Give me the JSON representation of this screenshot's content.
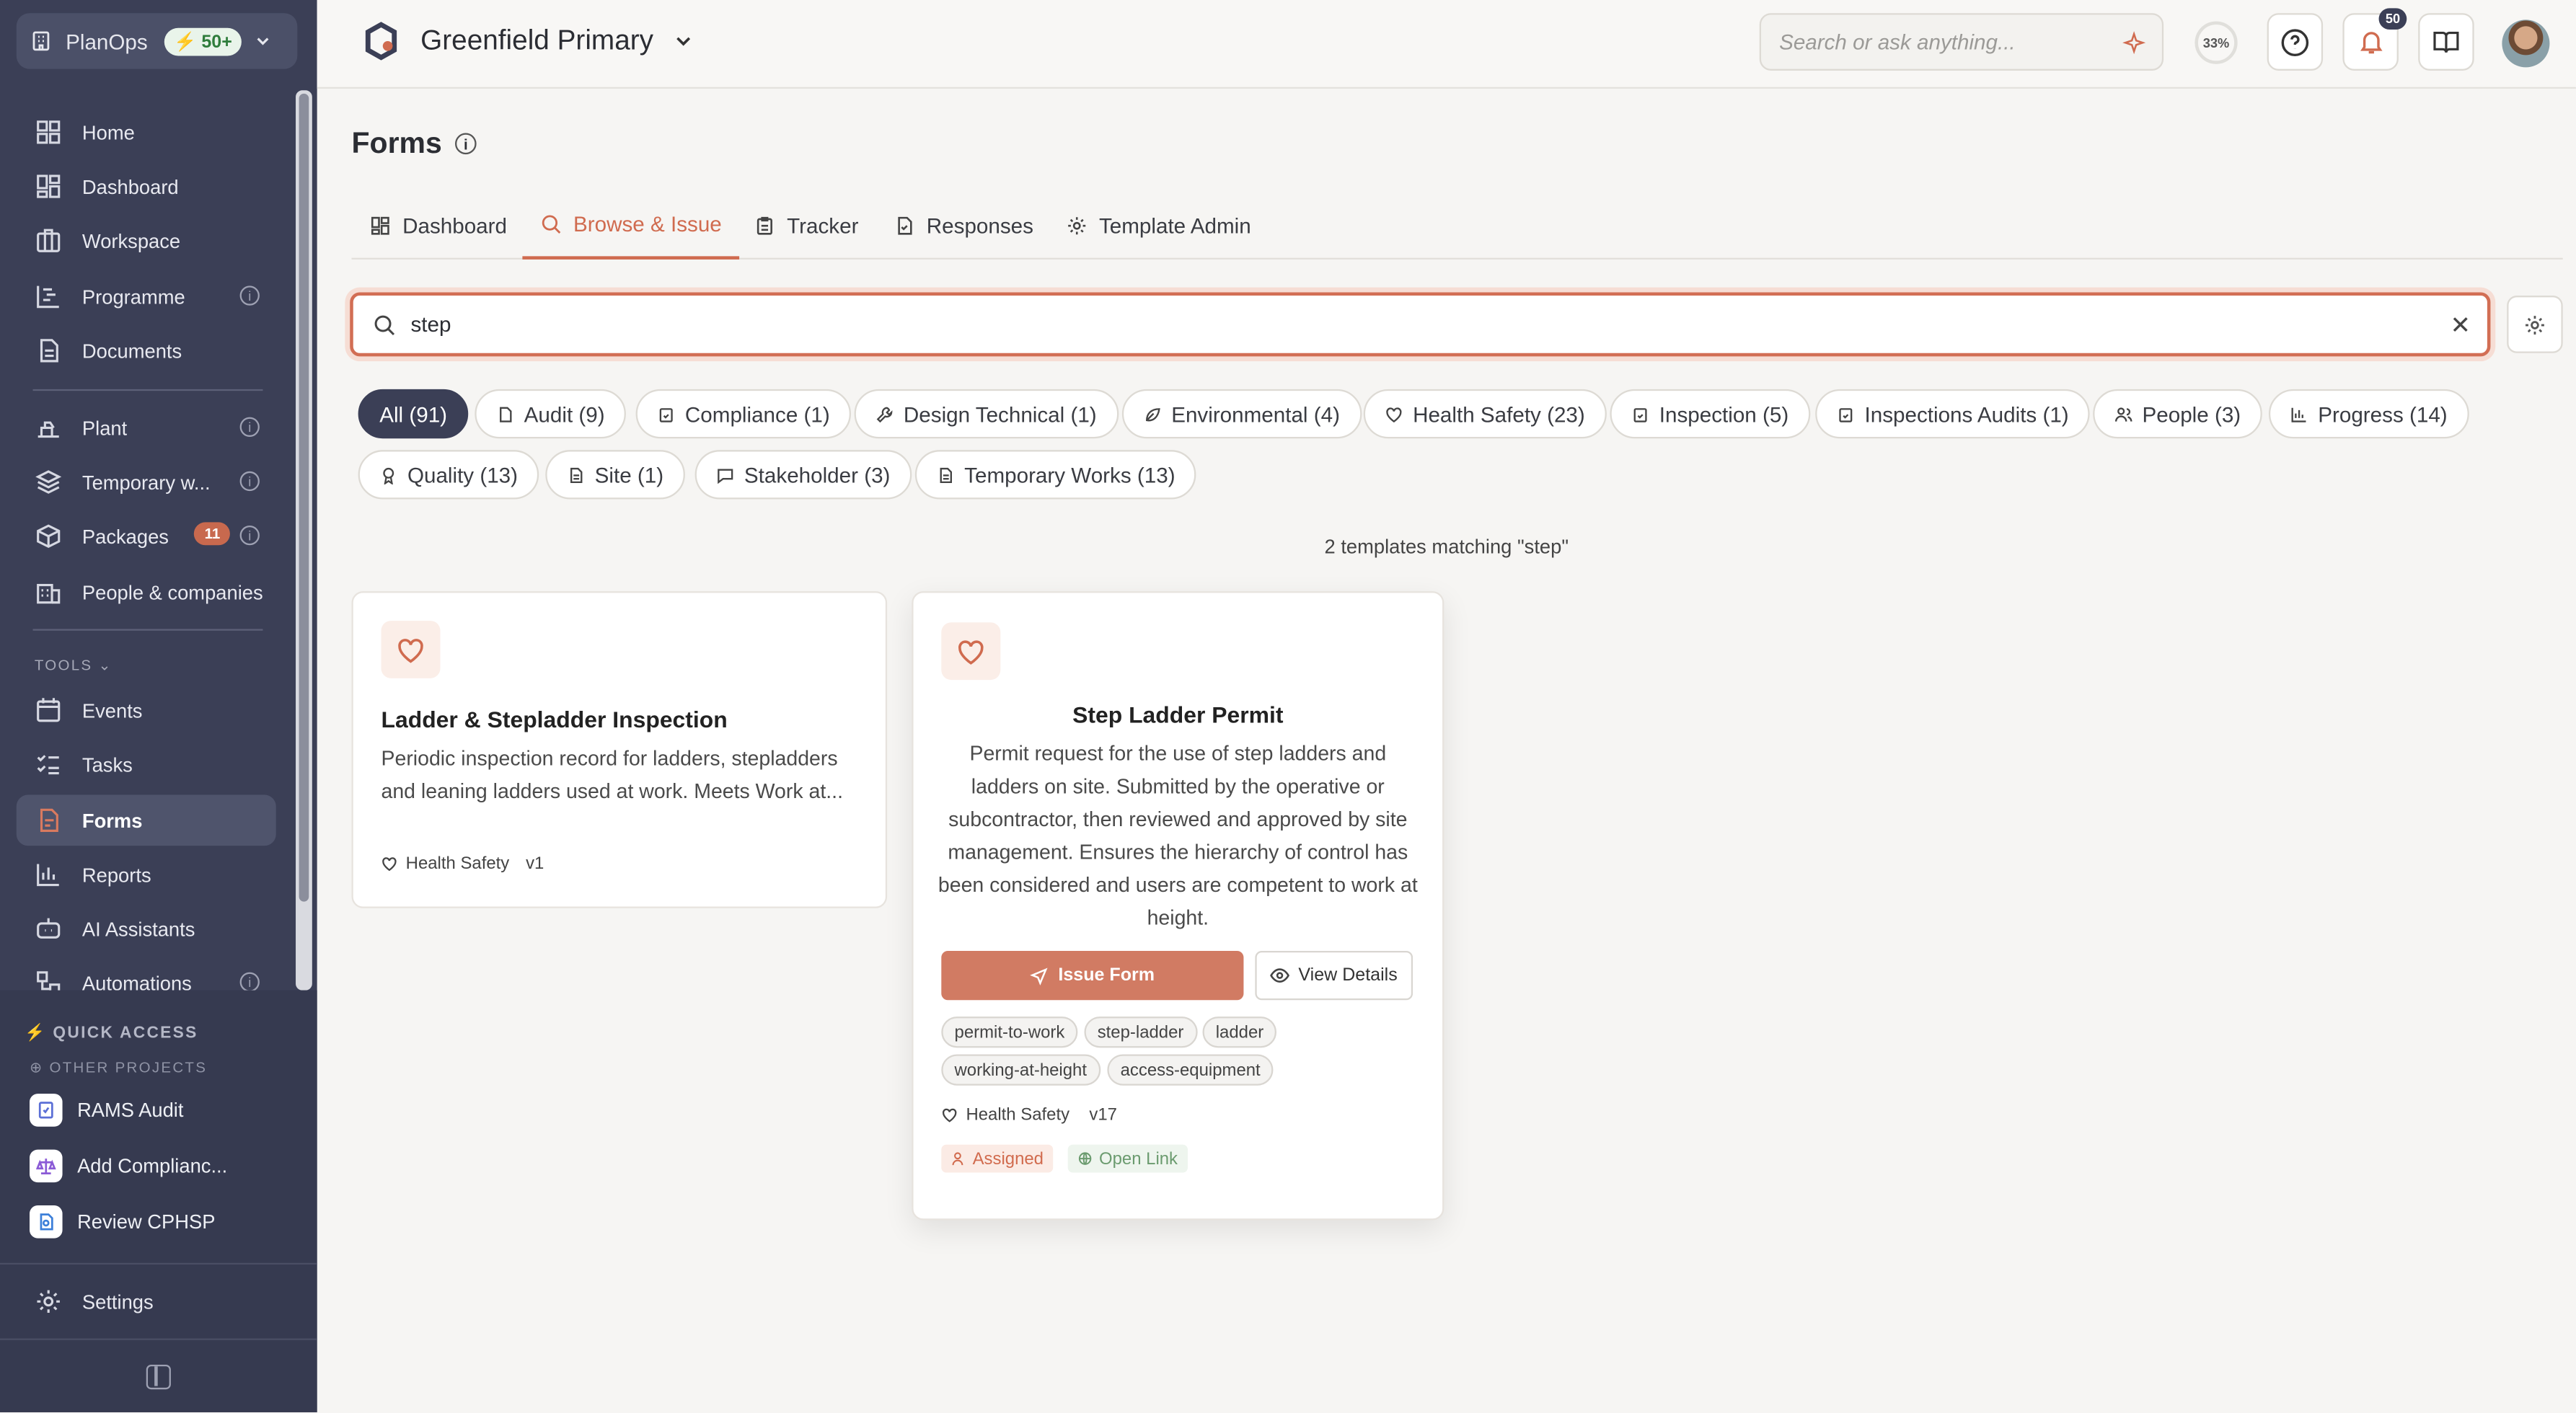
{
  "workspace": {
    "name": "PlanOps",
    "credits": "50+"
  },
  "sidebar": {
    "items": [
      {
        "label": "Home"
      },
      {
        "label": "Dashboard"
      },
      {
        "label": "Workspace"
      },
      {
        "label": "Programme"
      },
      {
        "label": "Documents"
      },
      {
        "label": "Plant"
      },
      {
        "label": "Temporary w..."
      },
      {
        "label": "Packages",
        "count": "11"
      },
      {
        "label": "People & companies"
      }
    ],
    "tools_label": "TOOLS",
    "tools": [
      {
        "label": "Events"
      },
      {
        "label": "Tasks"
      },
      {
        "label": "Forms"
      },
      {
        "label": "Reports"
      },
      {
        "label": "AI Assistants"
      },
      {
        "label": "Automations"
      }
    ],
    "quick_access_label": "QUICK ACCESS",
    "other_projects_label": "OTHER PROJECTS",
    "quick_items": [
      {
        "label": "RAMS Audit"
      },
      {
        "label": "Add Complianc..."
      },
      {
        "label": "Review CPHSP"
      }
    ],
    "settings_label": "Settings"
  },
  "topbar": {
    "project": "Greenfield Primary",
    "search_placeholder": "Search or ask anything...",
    "progress": "33%",
    "notifications": "50"
  },
  "page": {
    "title": "Forms"
  },
  "tabs": [
    {
      "label": "Dashboard"
    },
    {
      "label": "Browse & Issue"
    },
    {
      "label": "Tracker"
    },
    {
      "label": "Responses"
    },
    {
      "label": "Template Admin"
    }
  ],
  "search": {
    "value": "step"
  },
  "filters": [
    {
      "label": "All (91)"
    },
    {
      "label": "Audit (9)"
    },
    {
      "label": "Compliance (1)"
    },
    {
      "label": "Design Technical (1)"
    },
    {
      "label": "Environmental (4)"
    },
    {
      "label": "Health Safety (23)"
    },
    {
      "label": "Inspection (5)"
    },
    {
      "label": "Inspections Audits (1)"
    },
    {
      "label": "People (3)"
    },
    {
      "label": "Progress (14)"
    },
    {
      "label": "Quality (13)"
    },
    {
      "label": "Site (1)"
    },
    {
      "label": "Stakeholder (3)"
    },
    {
      "label": "Temporary Works (13)"
    }
  ],
  "results_summary": "2 templates matching \"step\"",
  "cards": [
    {
      "title": "Ladder & Stepladder Inspection",
      "description_line1": "Periodic inspection record for ladders, stepladders",
      "description_line2": "and leaning ladders used at work. Meets Work at...",
      "category": "Health Safety",
      "version": "v1"
    },
    {
      "title": "Step Ladder Permit",
      "description_lines": [
        "Permit request for the use of step ladders and",
        "ladders on site. Submitted by the operative or",
        "subcontractor, then reviewed and approved by site",
        "management. Ensures the hierarchy of control has",
        "been considered and users are competent to work at",
        "height."
      ],
      "issue_label": "Issue Form",
      "view_label": "View Details",
      "tags": [
        "permit-to-work",
        "step-ladder",
        "ladder",
        "working-at-height",
        "access-equipment"
      ],
      "category": "Health Safety",
      "version": "v17",
      "assigned_label": "Assigned",
      "open_link_label": "Open Link"
    }
  ],
  "colors": {
    "accent": "#d06b4f",
    "sidebar": "#3b3f56"
  }
}
